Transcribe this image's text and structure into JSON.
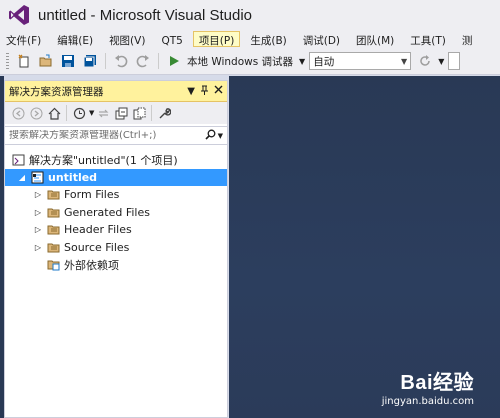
{
  "window": {
    "title": "untitled - Microsoft Visual Studio"
  },
  "menu": {
    "items": [
      {
        "label": "文件(F)"
      },
      {
        "label": "编辑(E)"
      },
      {
        "label": "视图(V)"
      },
      {
        "label": "QT5"
      },
      {
        "label": "项目(P)",
        "active": true
      },
      {
        "label": "生成(B)"
      },
      {
        "label": "调试(D)"
      },
      {
        "label": "团队(M)"
      },
      {
        "label": "工具(T)"
      },
      {
        "label": "测"
      }
    ]
  },
  "toolbar": {
    "start_label": "本地 Windows 调试器",
    "config_value": "自动"
  },
  "solution_explorer": {
    "title": "解决方案资源管理器",
    "search_placeholder": "搜索解决方案资源管理器(Ctrl+;)",
    "solution_label": "解决方案\"untitled\"(1 个项目)",
    "project_label": "untitled",
    "folders": [
      {
        "label": "Form Files"
      },
      {
        "label": "Generated Files"
      },
      {
        "label": "Header Files"
      },
      {
        "label": "Source Files"
      }
    ],
    "external_label": "外部依赖项"
  },
  "watermark": {
    "main": "Bai经验",
    "sub": "jingyan.baidu.com"
  },
  "colors": {
    "accent": "#3399ff",
    "panel_header": "#fff29d",
    "editor_bg": "#293955",
    "vs_purple": "#68217a"
  },
  "icons": [
    "vs-logo-icon",
    "new-project-icon",
    "open-folder-icon",
    "save-icon",
    "save-all-icon",
    "undo-icon",
    "redo-icon",
    "play-icon",
    "refresh-icon",
    "back-icon",
    "forward-icon",
    "home-icon",
    "history-icon",
    "sync-icon",
    "collapse-icon",
    "show-all-icon",
    "properties-icon",
    "search-icon",
    "pin-icon",
    "close-icon",
    "solution-icon",
    "project-icon",
    "folder-filter-icon",
    "external-deps-icon"
  ]
}
